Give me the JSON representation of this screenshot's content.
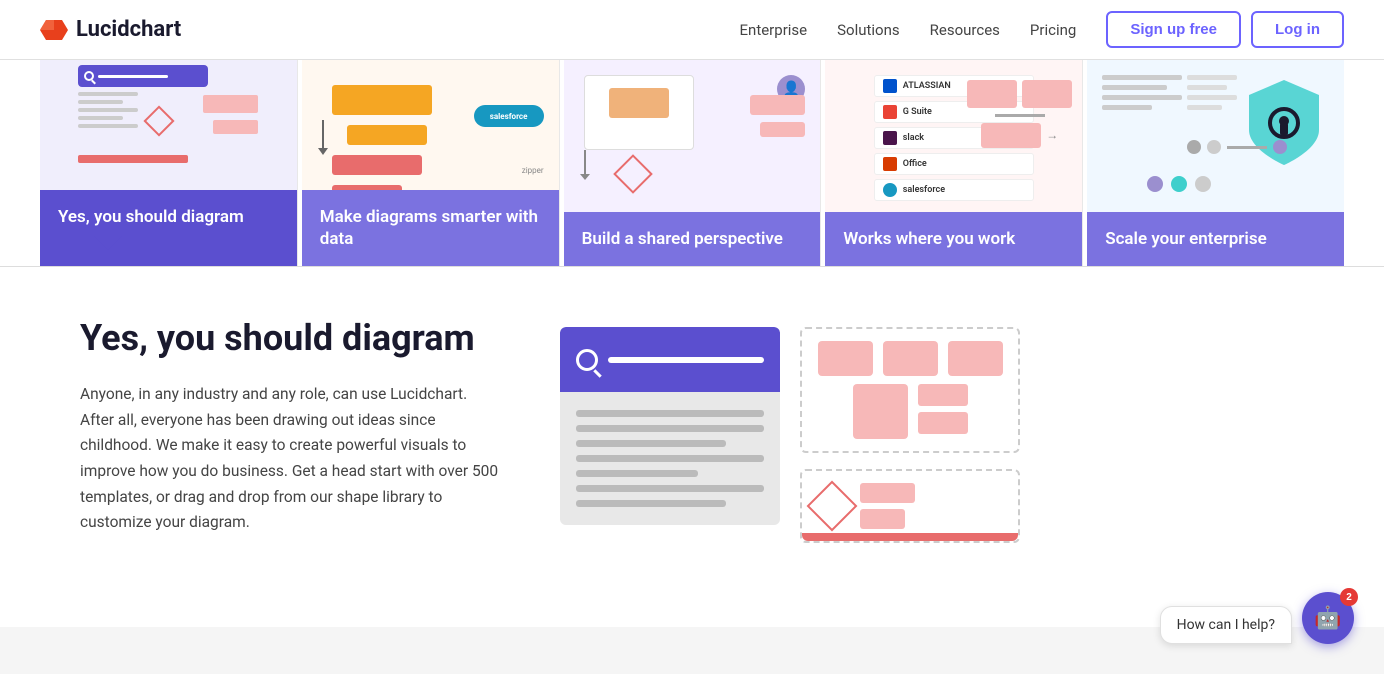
{
  "brand": {
    "name": "Lucidchart"
  },
  "nav": {
    "links": [
      {
        "id": "enterprise",
        "label": "Enterprise"
      },
      {
        "id": "solutions",
        "label": "Solutions"
      },
      {
        "id": "resources",
        "label": "Resources"
      },
      {
        "id": "pricing",
        "label": "Pricing"
      }
    ],
    "signup_label": "Sign up free",
    "login_label": "Log in"
  },
  "tabs": [
    {
      "id": "tab-diagram",
      "label": "Yes, you should diagram",
      "active": true
    },
    {
      "id": "tab-smarter",
      "label": "Make diagrams smarter with data",
      "active": false
    },
    {
      "id": "tab-perspective",
      "label": "Build a shared perspective",
      "active": false
    },
    {
      "id": "tab-works",
      "label": "Works where you work",
      "active": false
    },
    {
      "id": "tab-enterprise",
      "label": "Scale your enterprise",
      "active": false
    }
  ],
  "content": {
    "title": "Yes, you should diagram",
    "description": "Anyone, in any industry and any role, can use Lucidchart. After all, everyone has been drawing out ideas since childhood. We make it easy to create powerful visuals to improve how you do business. Get a head start with over 500 templates, or drag and drop from our shape library to customize your diagram."
  },
  "chat": {
    "bubble_text": "How can I help?",
    "badge_count": "2"
  },
  "integrations": {
    "atlassian_label": "ATLASSIAN",
    "gsuite_label": "G Suite",
    "slack_label": "slack",
    "office_label": "Office",
    "salesforce_label": "salesforce"
  }
}
